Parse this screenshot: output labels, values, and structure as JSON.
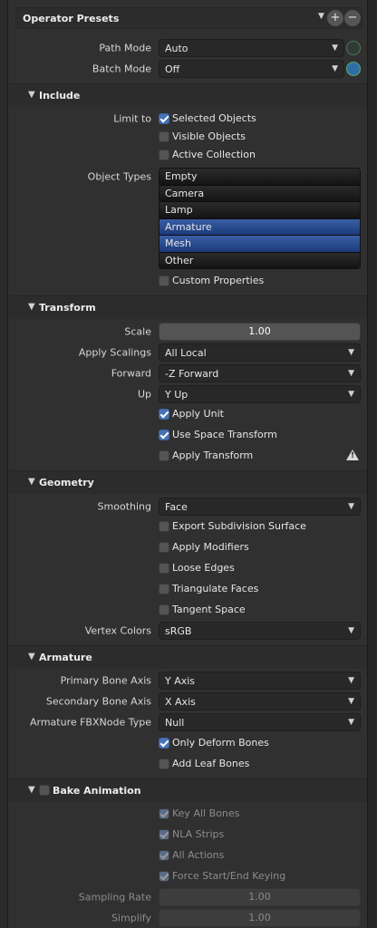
{
  "presets": {
    "label": "Operator Presets",
    "add_label": "+",
    "remove_label": "−"
  },
  "main": {
    "path_mode": {
      "label": "Path Mode",
      "value": "Auto"
    },
    "batch_mode": {
      "label": "Batch Mode",
      "value": "Off"
    }
  },
  "include": {
    "title": "Include",
    "limit_to_label": "Limit to",
    "limit_options": [
      {
        "label": "Selected Objects",
        "checked": true
      },
      {
        "label": "Visible Objects",
        "checked": false
      },
      {
        "label": "Active Collection",
        "checked": false
      }
    ],
    "object_types_label": "Object Types",
    "object_types": [
      {
        "label": "Empty",
        "selected": false
      },
      {
        "label": "Camera",
        "selected": false
      },
      {
        "label": "Lamp",
        "selected": false
      },
      {
        "label": "Armature",
        "selected": true
      },
      {
        "label": "Mesh",
        "selected": true
      },
      {
        "label": "Other",
        "selected": false
      }
    ],
    "custom_properties": {
      "label": "Custom Properties",
      "checked": false
    }
  },
  "transform": {
    "title": "Transform",
    "scale": {
      "label": "Scale",
      "value": "1.00"
    },
    "apply_scalings": {
      "label": "Apply Scalings",
      "value": "All Local"
    },
    "forward": {
      "label": "Forward",
      "value": "-Z Forward"
    },
    "up": {
      "label": "Up",
      "value": "Y Up"
    },
    "apply_unit": {
      "label": "Apply Unit",
      "checked": true
    },
    "use_space_transform": {
      "label": "Use Space Transform",
      "checked": true
    },
    "apply_transform": {
      "label": "Apply Transform",
      "checked": false
    }
  },
  "geometry": {
    "title": "Geometry",
    "smoothing": {
      "label": "Smoothing",
      "value": "Face"
    },
    "options": [
      {
        "label": "Export Subdivision Surface",
        "checked": false
      },
      {
        "label": "Apply Modifiers",
        "checked": false
      },
      {
        "label": "Loose Edges",
        "checked": false
      },
      {
        "label": "Triangulate Faces",
        "checked": false
      },
      {
        "label": "Tangent Space",
        "checked": false
      }
    ],
    "vertex_colors": {
      "label": "Vertex Colors",
      "value": "sRGB"
    }
  },
  "armature": {
    "title": "Armature",
    "primary_bone_axis": {
      "label": "Primary Bone Axis",
      "value": "Y Axis"
    },
    "secondary_bone_axis": {
      "label": "Secondary Bone Axis",
      "value": "X Axis"
    },
    "node_type": {
      "label": "Armature FBXNode Type",
      "value": "Null"
    },
    "only_deform_bones": {
      "label": "Only Deform Bones",
      "checked": true
    },
    "add_leaf_bones": {
      "label": "Add Leaf Bones",
      "checked": false
    }
  },
  "bake_animation": {
    "title": "Bake Animation",
    "enabled": false,
    "options": [
      {
        "label": "Key All Bones",
        "checked": true
      },
      {
        "label": "NLA Strips",
        "checked": true
      },
      {
        "label": "All Actions",
        "checked": true
      },
      {
        "label": "Force Start/End Keying",
        "checked": true
      }
    ],
    "sampling_rate": {
      "label": "Sampling Rate",
      "value": "1.00"
    },
    "simplify": {
      "label": "Simplify",
      "value": "1.00"
    }
  },
  "colors": {
    "background": "#303030",
    "accent": "#4772b3",
    "field": "#545454",
    "dropdown": "#282828"
  }
}
